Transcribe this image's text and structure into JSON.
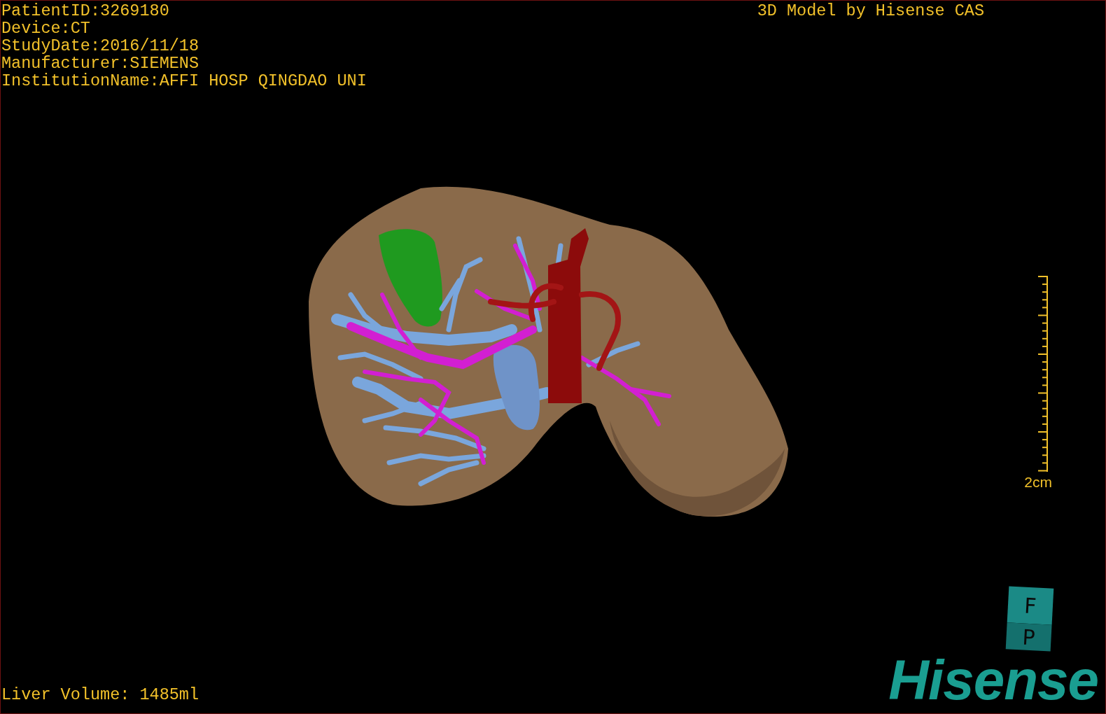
{
  "study_info": [
    "PatientID:3269180",
    "Device:CT",
    "StudyDate:2016/11/18",
    "Manufacturer:SIEMENS",
    "InstitutionName:AFFI HOSP QINGDAO UNI"
  ],
  "caption": "3D Model by Hisense CAS",
  "scale_bar": {
    "label": "2cm"
  },
  "liver_volume": "Liver Volume: 1485ml",
  "orientation_cube": {
    "top": "F",
    "front": "P"
  },
  "logo": "Hisense"
}
